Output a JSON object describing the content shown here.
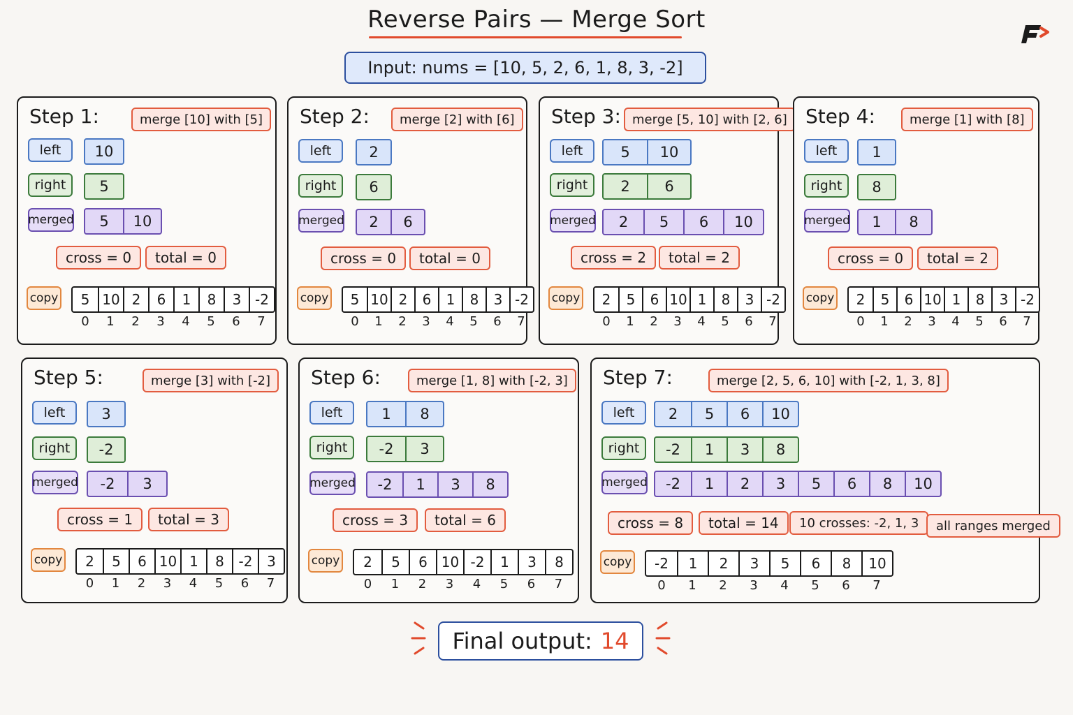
{
  "title": "Reverse Pairs — Merge Sort",
  "input": "Input:  nums = [10, 5, 2, 6, 1, 8, 3, -2]",
  "labels": {
    "left": "left",
    "right": "right",
    "merged": "merged",
    "copy": "copy"
  },
  "indices": [
    "0",
    "1",
    "2",
    "3",
    "4",
    "5",
    "6",
    "7"
  ],
  "colors": {
    "accent": "#e14a2c",
    "blue": "#2c4f9e",
    "left": "#4a78c2",
    "right": "#3b7a3b",
    "merged": "#6a4fb0",
    "tag": "#e25c3f"
  },
  "steps": [
    {
      "title": "Step 1:",
      "merge": "merge [10] with [5]",
      "left": [
        "10"
      ],
      "right": [
        "5"
      ],
      "merged": [
        "5",
        "10"
      ],
      "cross": "cross = 0",
      "total": "total = 0",
      "extras": [],
      "copy": [
        "5",
        "10",
        "2",
        "6",
        "1",
        "8",
        "3",
        "-2"
      ]
    },
    {
      "title": "Step 2:",
      "merge": "merge [2] with [6]",
      "left": [
        "2"
      ],
      "right": [
        "6"
      ],
      "merged": [
        "2",
        "6"
      ],
      "cross": "cross = 0",
      "total": "total = 0",
      "extras": [],
      "copy": [
        "5",
        "10",
        "2",
        "6",
        "1",
        "8",
        "3",
        "-2"
      ]
    },
    {
      "title": "Step 3:",
      "merge": "merge [5, 10] with [2, 6]",
      "left": [
        "5",
        "10"
      ],
      "right": [
        "2",
        "6"
      ],
      "merged": [
        "2",
        "5",
        "6",
        "10"
      ],
      "cross": "cross = 2",
      "total": "total = 2",
      "extras": [],
      "copy": [
        "2",
        "5",
        "6",
        "10",
        "1",
        "8",
        "3",
        "-2"
      ]
    },
    {
      "title": "Step 4:",
      "merge": "merge [1] with [8]",
      "left": [
        "1"
      ],
      "right": [
        "8"
      ],
      "merged": [
        "1",
        "8"
      ],
      "cross": "cross = 0",
      "total": "total = 2",
      "extras": [],
      "copy": [
        "2",
        "5",
        "6",
        "10",
        "1",
        "8",
        "3",
        "-2"
      ]
    },
    {
      "title": "Step 5:",
      "merge": "merge [3] with [-2]",
      "left": [
        "3"
      ],
      "right": [
        "-2"
      ],
      "merged": [
        "-2",
        "3"
      ],
      "cross": "cross = 1",
      "total": "total = 3",
      "extras": [],
      "copy": [
        "2",
        "5",
        "6",
        "10",
        "1",
        "8",
        "-2",
        "3"
      ]
    },
    {
      "title": "Step 6:",
      "merge": "merge [1, 8] with [-2, 3]",
      "left": [
        "1",
        "8"
      ],
      "right": [
        "-2",
        "3"
      ],
      "merged": [
        "-2",
        "1",
        "3",
        "8"
      ],
      "cross": "cross = 3",
      "total": "total = 6",
      "extras": [],
      "copy": [
        "2",
        "5",
        "6",
        "10",
        "-2",
        "1",
        "3",
        "8"
      ]
    },
    {
      "title": "Step 7:",
      "merge": "merge [2, 5, 6, 10] with [-2, 1, 3, 8]",
      "left": [
        "2",
        "5",
        "6",
        "10"
      ],
      "right": [
        "-2",
        "1",
        "3",
        "8"
      ],
      "merged": [
        "-2",
        "1",
        "2",
        "3",
        "5",
        "6",
        "8",
        "10"
      ],
      "cross": "cross = 8",
      "total": "total = 14",
      "extras": [
        "10 crosses: -2, 1, 3",
        "all ranges merged"
      ],
      "copy": [
        "-2",
        "1",
        "2",
        "3",
        "5",
        "6",
        "8",
        "10"
      ]
    }
  ],
  "final": {
    "label": "Final output:",
    "value": "14"
  }
}
